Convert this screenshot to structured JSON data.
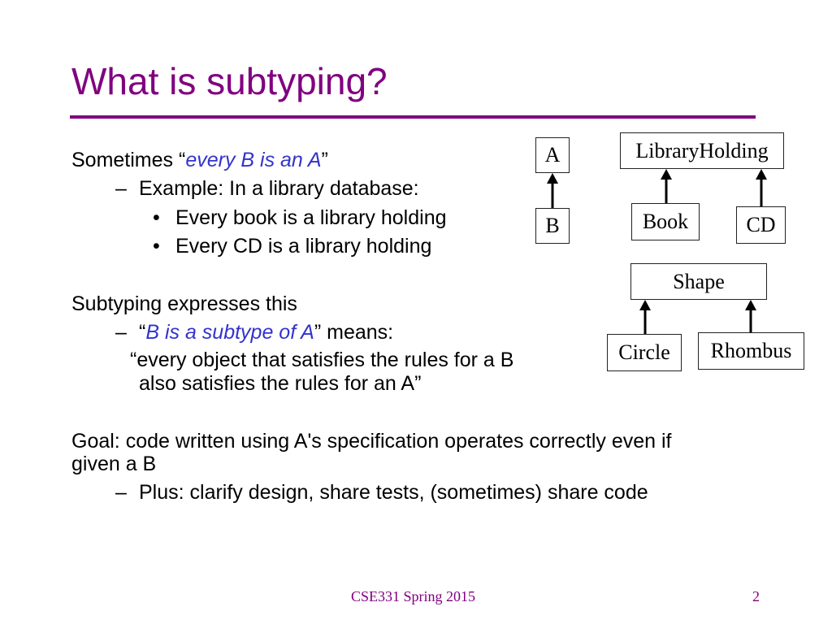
{
  "slide": {
    "title": "What is subtyping?",
    "bullets": {
      "b1_prefix": "Sometimes “",
      "b1_emph": "every B is an A",
      "b1_suffix": "”",
      "b1_sub_dash": "–",
      "b1_sub": "Example: In a library database:",
      "b1_dot": "•",
      "b1_items": [
        "Every book is a library holding",
        "Every CD is a library holding"
      ],
      "b2": "Subtyping expresses this",
      "b2_sub_dash": "–",
      "b2_sub_prefix": "“",
      "b2_sub_emph": "B is a subtype of A",
      "b2_sub_suffix": "” means:",
      "b2_quote_line1": "“every object that satisfies the rules for a B",
      "b2_quote_line2": "also satisfies the rules for an A”",
      "b3_line1": "Goal: code written using A's specification operates correctly even if",
      "b3_line2": "given a B",
      "b3_sub_dash": "–",
      "b3_sub": "Plus:  clarify design, share tests, (sometimes) share code"
    },
    "diagram": {
      "boxes": {
        "a": "A",
        "b": "B",
        "library_holding": "LibraryHolding",
        "book": "Book",
        "cd": "CD",
        "shape": "Shape",
        "circle": "Circle",
        "rhombus": "Rhombus"
      }
    },
    "footer": {
      "course": "CSE331 Spring 2015",
      "page_number": "2"
    },
    "colors": {
      "accent": "#800080",
      "emphasis": "#3333cc"
    }
  }
}
